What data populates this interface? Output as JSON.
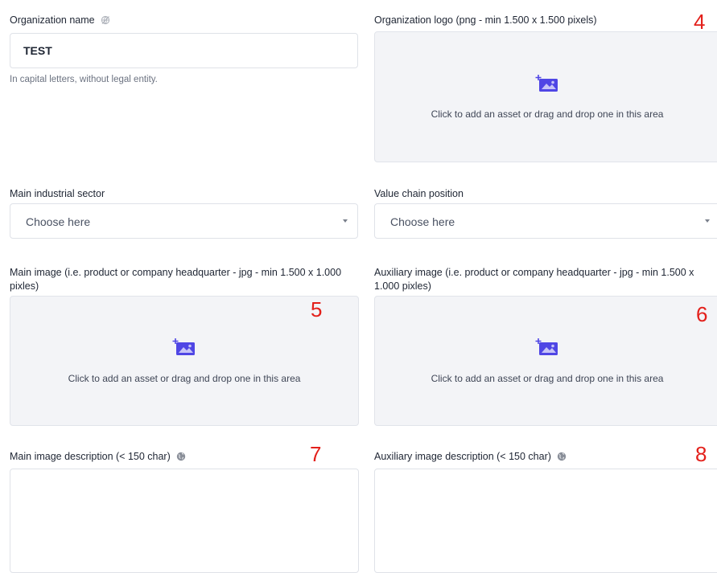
{
  "org_name": {
    "label": "Organization name",
    "value": "TEST",
    "hint": "In capital letters, without legal entity.",
    "icon": "translate-disabled-icon"
  },
  "org_logo": {
    "label": "Organization logo (png - min 1.500 x 1.500 pixels)",
    "dropzone_text": "Click to add an asset or drag and drop one in this area",
    "marker": "4"
  },
  "sector": {
    "label": "Main industrial sector",
    "placeholder": "Choose here"
  },
  "value_chain": {
    "label": "Value chain position",
    "placeholder": "Choose here"
  },
  "main_image": {
    "label": "Main image (i.e. product or company headquarter - jpg - min 1.500 x 1.000 pixles)",
    "dropzone_text": "Click to add an asset or drag and drop one in this area",
    "marker": "5"
  },
  "aux_image": {
    "label": "Auxiliary image (i.e. product or company headquarter - jpg - min 1.500 x 1.000 pixles)",
    "dropzone_text": "Click to add an asset or drag and drop one in this area",
    "marker": "6"
  },
  "main_desc": {
    "label": "Main image description (< 150 char)",
    "icon": "globe-icon",
    "marker": "7"
  },
  "aux_desc": {
    "label": "Auxiliary image description (< 150 char)",
    "icon": "globe-icon",
    "marker": "8"
  },
  "colors": {
    "accent": "#4f46e5",
    "marker": "#e3201b",
    "dropzone_bg": "#f3f4f7"
  }
}
